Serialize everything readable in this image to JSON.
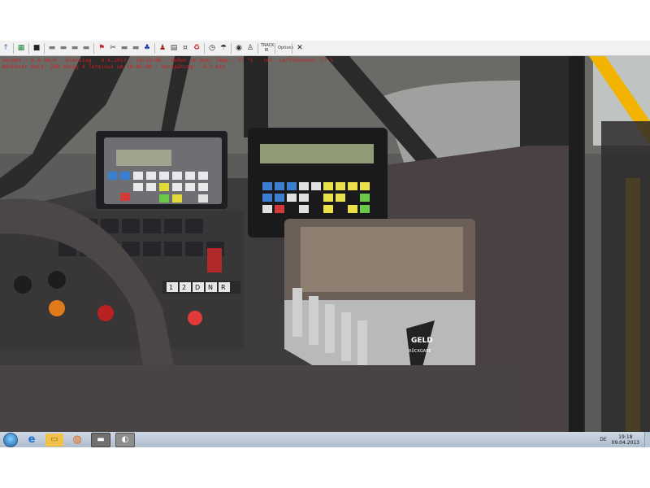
{
  "toolbar": {
    "buttons": [
      {
        "icon": "arrow-up-icon",
        "glyph": "↑"
      },
      {
        "icon": "map-icon",
        "glyph": "▦"
      },
      {
        "icon": "save-icon",
        "glyph": "■"
      },
      {
        "icon": "bus-icon",
        "glyph": "▬"
      },
      {
        "icon": "bus-icon",
        "glyph": "▬"
      },
      {
        "icon": "bus-icon",
        "glyph": "▬"
      },
      {
        "icon": "bus-icon",
        "glyph": "▬"
      },
      {
        "icon": "route-icon",
        "glyph": "⚑"
      },
      {
        "icon": "wrench-icon",
        "glyph": "✂"
      },
      {
        "icon": "bus-icon",
        "glyph": "▬"
      },
      {
        "icon": "bus-icon",
        "glyph": "▬"
      },
      {
        "icon": "bell-icon",
        "glyph": "♣"
      },
      {
        "icon": "person-icon",
        "glyph": "♟"
      },
      {
        "icon": "timetable-icon",
        "glyph": "▤"
      },
      {
        "icon": "ticket-icon",
        "glyph": "¤"
      },
      {
        "icon": "recycle-icon",
        "glyph": "♻"
      },
      {
        "icon": "clock-icon",
        "glyph": "◷"
      },
      {
        "icon": "weather-icon",
        "glyph": "☂"
      },
      {
        "icon": "camera-icon",
        "glyph": "◉"
      },
      {
        "icon": "passenger-icon",
        "glyph": "♙"
      }
    ],
    "track_label": "TRACK IR",
    "options_label": "Options",
    "close_glyph": "✕"
  },
  "hud": {
    "line1": "Gesamt.: 0.0 km/h - Dienstag - 9.4.2013 - 18:13:06 - Außen im Bus: Temp.: 17 °C - rel. Luftfeuchte: 77 %",
    "line2": "Nächster Halt: ZOB Steig 4 Terminus um 18:06:00 - Verspätung: -4.2 min"
  },
  "cockpit": {
    "ibis_display": "",
    "ticket_display": "",
    "gear_buttons": [
      "1",
      "2",
      "D",
      "N",
      "R"
    ],
    "coin_changer_brand": "GELD",
    "coin_changer_text": "RÜCKGABE"
  },
  "taskbar": {
    "apps": [
      {
        "icon": "windows-start-icon"
      },
      {
        "icon": "internet-explorer-icon",
        "glyph": "e"
      },
      {
        "icon": "file-explorer-icon",
        "glyph": "▭"
      },
      {
        "icon": "firefox-icon",
        "glyph": "◍"
      },
      {
        "icon": "omsi-icon",
        "glyph": "▬"
      },
      {
        "icon": "omsi-editor-icon",
        "glyph": "◐"
      }
    ],
    "language": "DE",
    "time": "19:18",
    "date": "09.04.2013"
  },
  "colors": {
    "hud_text": "#d21e1e",
    "toolbar_bg": "#f1f1f1",
    "dash": "#3a3a3c",
    "yellow_pole": "#f2b400",
    "lcd": "#8f9a77"
  }
}
